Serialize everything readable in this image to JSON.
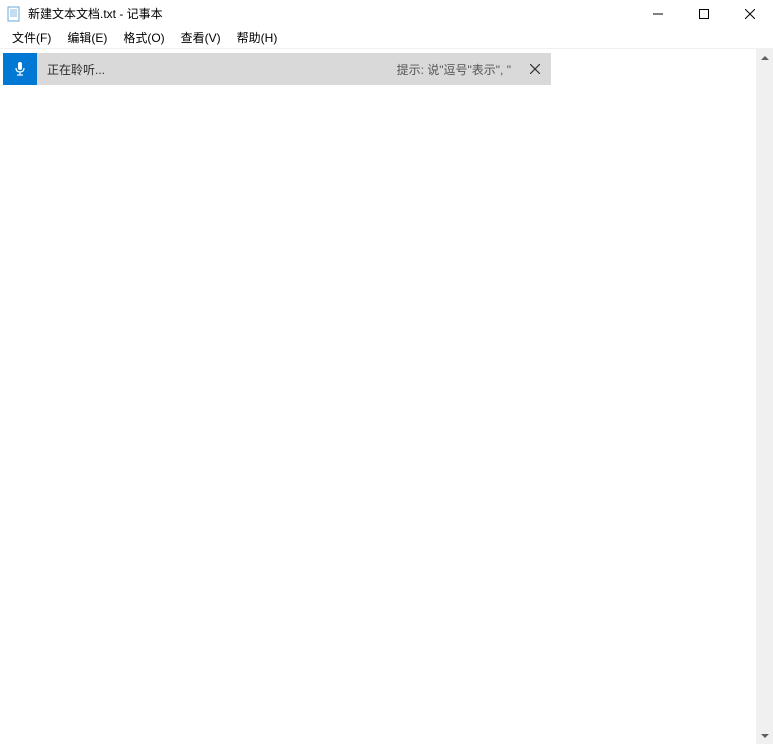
{
  "titlebar": {
    "title": "新建文本文档.txt - 记事本"
  },
  "menubar": {
    "items": [
      {
        "label": "文件(F)"
      },
      {
        "label": "编辑(E)"
      },
      {
        "label": "格式(O)"
      },
      {
        "label": "查看(V)"
      },
      {
        "label": "帮助(H)"
      }
    ]
  },
  "dictation": {
    "status": "正在聆听...",
    "hint": "提示: 说\"逗号\"表示\",   \""
  }
}
